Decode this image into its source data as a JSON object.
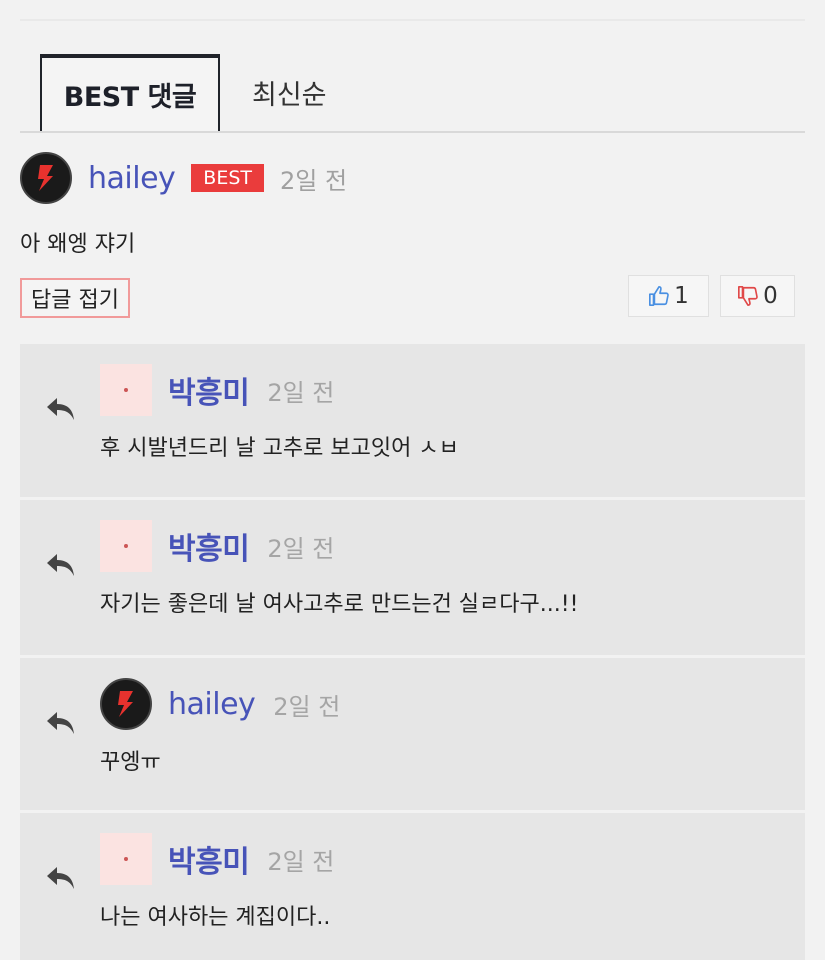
{
  "tabs": {
    "best": "BEST 댓글",
    "latest": "최신순"
  },
  "comment": {
    "username": "hailey",
    "badge": "BEST",
    "time": "2일 전",
    "text": "아 왜엥 쟈기",
    "fold_label": "답글 접기",
    "likes": "1",
    "dislikes": "0"
  },
  "replies": [
    {
      "username": "박흥미",
      "avatar": "pink-avatar",
      "time": "2일 전",
      "text": "후 시발년드리 날 고추로 보고잇어 ㅅㅂ"
    },
    {
      "username": "박흥미",
      "avatar": "pink-avatar",
      "time": "2일 전",
      "text": "자기는 좋은데 날 여사고추로 만드는건 실ㄹ다구...!!"
    },
    {
      "username": "hailey",
      "avatar": "dark-avatar",
      "time": "2일 전",
      "text": "꾸엥ㅠ"
    },
    {
      "username": "박흥미",
      "avatar": "pink-avatar",
      "time": "2일 전",
      "text": "나는 여사하는 계집이다.."
    }
  ],
  "colors": {
    "username": "#4753b8",
    "best_badge": "#ea3c3c",
    "like": "#4a90e2",
    "dislike": "#e04848"
  }
}
